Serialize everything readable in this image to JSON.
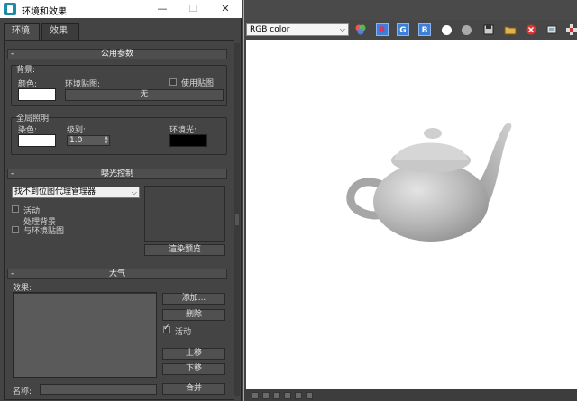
{
  "dialog": {
    "title": "环境和效果",
    "tabs": [
      "环境",
      "效果"
    ]
  },
  "common": {
    "heading": "公用参数",
    "background_group": "背景:",
    "color_label": "颜色:",
    "env_map_label": "环境贴图:",
    "use_map_label": "使用贴图",
    "env_map_value": "无",
    "global_lighting_group": "全局照明:",
    "tint_label": "染色:",
    "level_label": "级别:",
    "level_value": "1.0",
    "ambient_label": "环境光:"
  },
  "exposure": {
    "heading": "曝光控制",
    "selected": "找不到位图代理管理器",
    "active_label": "活动",
    "process_bg_label": "处理背景\n与环境贴图",
    "render_preview": "渲染预览"
  },
  "atmosphere": {
    "heading": "大气",
    "effects_label": "效果:",
    "add": "添加...",
    "delete": "删除",
    "active_label": "活动",
    "move_up": "上移",
    "move_down": "下移",
    "name_label": "名称:",
    "merge": "合并"
  },
  "frame": {
    "channel": "RGB color",
    "channel_buttons": [
      "R",
      "G",
      "B"
    ]
  },
  "colors": {
    "bg_swatch": "#ffffff",
    "tint_swatch": "#ffffff",
    "ambient_swatch": "#000000",
    "accent_blue": "#3e7fd8",
    "window_border": "#c9a463"
  },
  "icons": [
    "dialog-app-icon",
    "minimize-icon",
    "maximize-icon",
    "close-icon",
    "color-swatch-icon",
    "save-icon",
    "open-folder-icon",
    "clear-icon",
    "print-icon",
    "pan-icon",
    "teapot-render"
  ]
}
